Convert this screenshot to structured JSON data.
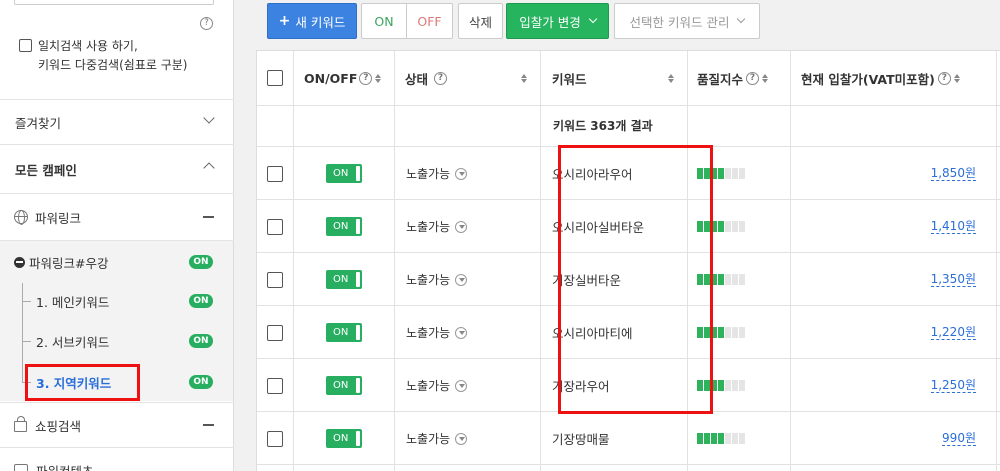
{
  "sidebar": {
    "exact_search_line1": "일치검색 사용 하기,",
    "exact_search_line2": "키워드 다중검색(쉼표로 구분)",
    "favorites": "즐겨찾기",
    "all_campaigns": "모든 캠페인",
    "powerlink": "파워링크",
    "campaign_name": "파워링크#우강",
    "campaign_status": "ON",
    "groups": [
      {
        "label": "1. 메인키워드",
        "status": "ON"
      },
      {
        "label": "2. 서브키워드",
        "status": "ON"
      },
      {
        "label": "3. 지역키워드",
        "status": "ON"
      }
    ],
    "shopping": "쇼핑검색",
    "partial_bottom": "파워컨텐츠"
  },
  "toolbar": {
    "new_keyword": "새 키워드",
    "on": "ON",
    "off": "OFF",
    "delete": "삭제",
    "bid_change": "입찰가 변경",
    "manage_selected": "선택한 키워드 관리"
  },
  "table": {
    "headers": {
      "onoff": "ON/OFF",
      "status": "상태",
      "keyword": "키워드",
      "quality": "품질지수",
      "bid": "현재 입찰가(VAT미포함)"
    },
    "result_summary": "키워드 363개 결과",
    "rows": [
      {
        "toggle": "ON",
        "status": "노출가능",
        "keyword": "오시리아라우어",
        "quality": 4,
        "bid": "1,850원"
      },
      {
        "toggle": "ON",
        "status": "노출가능",
        "keyword": "오시리아실버타운",
        "quality": 4,
        "bid": "1,410원"
      },
      {
        "toggle": "ON",
        "status": "노출가능",
        "keyword": "기장실버타운",
        "quality": 4,
        "bid": "1,350원"
      },
      {
        "toggle": "ON",
        "status": "노출가능",
        "keyword": "오시리아마티에",
        "quality": 4,
        "bid": "1,220원"
      },
      {
        "toggle": "ON",
        "status": "노출가능",
        "keyword": "기장라우어",
        "quality": 4,
        "bid": "1,250원"
      },
      {
        "toggle": "ON",
        "status": "노출가능",
        "keyword": "기장땅매물",
        "quality": 4,
        "bid": "990원"
      }
    ]
  },
  "colors": {
    "accent_blue": "#3c82e0",
    "accent_green": "#27b45e",
    "highlight_red": "#ee1111"
  }
}
